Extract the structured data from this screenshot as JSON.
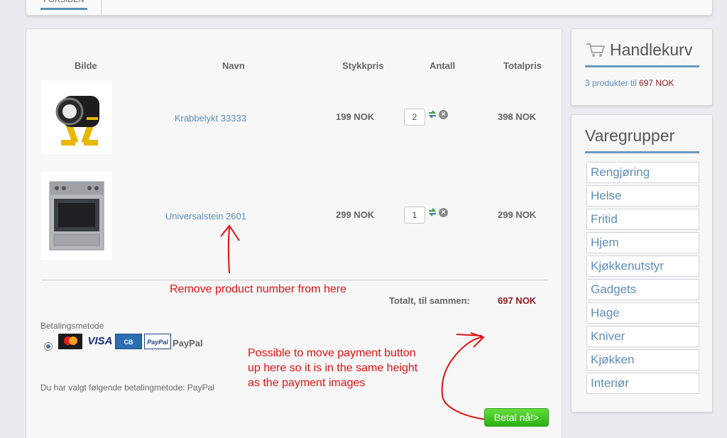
{
  "nav": {
    "tab_label": "FORSIDEN"
  },
  "cart_table": {
    "headers": {
      "image": "Bilde",
      "name": "Navn",
      "unit_price": "Stykkpris",
      "quantity": "Antall",
      "total_price": "Totalpris"
    },
    "rows": [
      {
        "name": "Krabbelykt 33333",
        "unit_price": "199 NOK",
        "quantity": "2",
        "total": "398 NOK"
      },
      {
        "name": "Universalstein 2601",
        "unit_price": "299 NOK",
        "quantity": "1",
        "total": "299 NOK"
      }
    ],
    "total_label": "Totalt, til sammen:",
    "total_value": "697 NOK"
  },
  "payment": {
    "label": "Betalingsmetode",
    "cards": [
      "MasterCard",
      "VISA",
      "CB",
      "PayPal"
    ],
    "method_name": "PayPal",
    "chosen_text": "Du har valgt følgende betalingmetode: PayPal",
    "pay_button": "Betal nå!>"
  },
  "annotations": {
    "remove_number": "Remove product number from here",
    "move_button_line1": "Possible to move payment button",
    "move_button_line2": "up here so it is in the same height",
    "move_button_line3": "as the payment images"
  },
  "cart_widget": {
    "title": "Handlekurv",
    "summary_prefix": "3 produkter til",
    "summary_amount": "697 NOK"
  },
  "categories": {
    "title": "Varegrupper",
    "items": [
      "Rengjøring",
      "Helse",
      "Fritid",
      "Hjem",
      "Kjøkkenutstyr",
      "Gadgets",
      "Hage",
      "Kniver",
      "Kjøkken",
      "Interiør"
    ]
  },
  "colors": {
    "accent": "#5e8db5",
    "price_red": "#8b1a1a",
    "pay_green": "#3cc420",
    "annotation": "#e01010"
  }
}
